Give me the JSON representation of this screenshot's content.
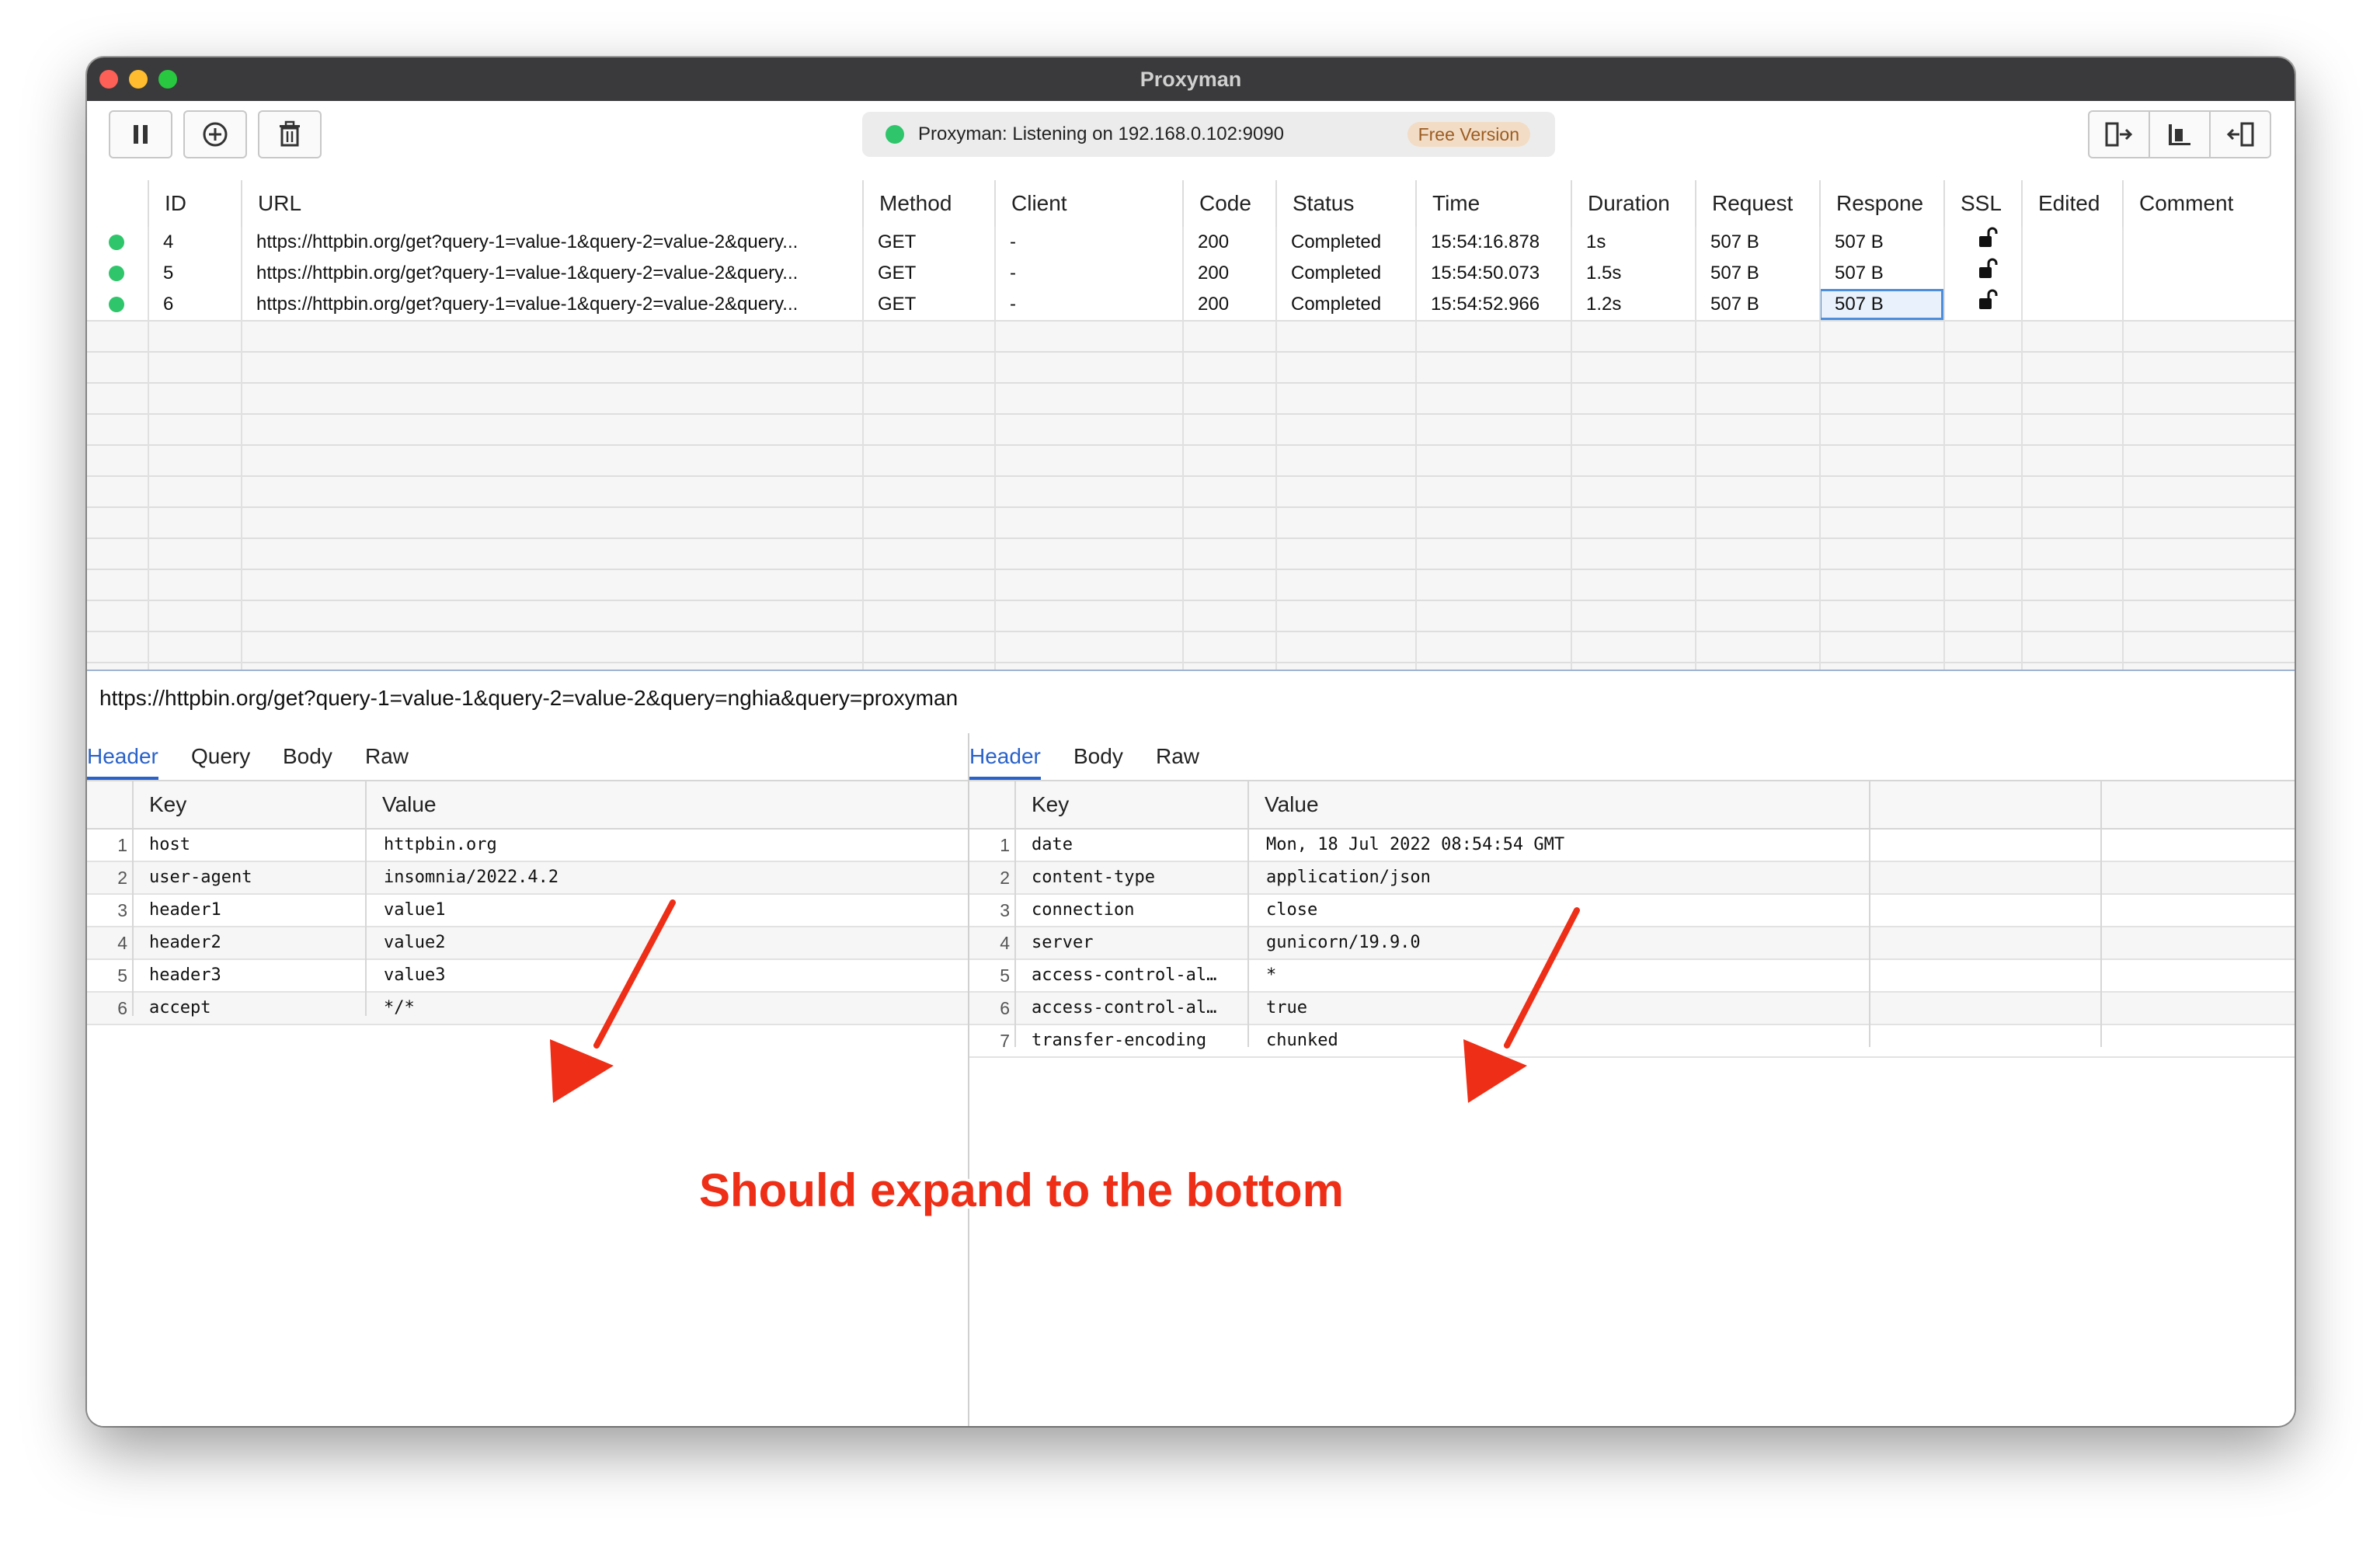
{
  "window": {
    "title": "Proxyman"
  },
  "toolbar": {
    "status_text": "Proxyman: Listening on 192.168.0.102:9090",
    "badge": "Free Version",
    "status_color": "#2fc56b"
  },
  "request_table": {
    "columns": [
      "ID",
      "URL",
      "Method",
      "Client",
      "Code",
      "Status",
      "Time",
      "Duration",
      "Request",
      "Respone",
      "SSL",
      "Edited",
      "Comment"
    ],
    "rows": [
      {
        "id": "4",
        "url": "https://httpbin.org/get?query-1=value-1&query-2=value-2&query...",
        "method": "GET",
        "client": "-",
        "code": "200",
        "status": "Completed",
        "time": "15:54:16.878",
        "duration": "1s",
        "request": "507 B",
        "response": "507 B"
      },
      {
        "id": "5",
        "url": "https://httpbin.org/get?query-1=value-1&query-2=value-2&query...",
        "method": "GET",
        "client": "-",
        "code": "200",
        "status": "Completed",
        "time": "15:54:50.073",
        "duration": "1.5s",
        "request": "507 B",
        "response": "507 B"
      },
      {
        "id": "6",
        "url": "https://httpbin.org/get?query-1=value-1&query-2=value-2&query...",
        "method": "GET",
        "client": "-",
        "code": "200",
        "status": "Completed",
        "time": "15:54:52.966",
        "duration": "1.2s",
        "request": "507 B",
        "response": "507 B"
      }
    ]
  },
  "detail": {
    "url": "https://httpbin.org/get?query-1=value-1&query-2=value-2&query=nghia&query=proxyman"
  },
  "request_pane": {
    "tabs": [
      "Header",
      "Query",
      "Body",
      "Raw"
    ],
    "columns": [
      "Key",
      "Value"
    ],
    "rows": [
      {
        "n": "1",
        "key": "host",
        "value": "httpbin.org"
      },
      {
        "n": "2",
        "key": "user-agent",
        "value": "insomnia/2022.4.2"
      },
      {
        "n": "3",
        "key": "header1",
        "value": "value1"
      },
      {
        "n": "4",
        "key": "header2",
        "value": "value2"
      },
      {
        "n": "5",
        "key": "header3",
        "value": "value3"
      },
      {
        "n": "6",
        "key": "accept",
        "value": "*/*"
      }
    ]
  },
  "response_pane": {
    "tabs": [
      "Header",
      "Body",
      "Raw"
    ],
    "columns": [
      "Key",
      "Value"
    ],
    "rows": [
      {
        "n": "1",
        "key": "date",
        "value": "Mon, 18 Jul 2022 08:54:54 GMT"
      },
      {
        "n": "2",
        "key": "content-type",
        "value": "application/json"
      },
      {
        "n": "3",
        "key": "connection",
        "value": "close"
      },
      {
        "n": "4",
        "key": "server",
        "value": "gunicorn/19.9.0"
      },
      {
        "n": "5",
        "key": "access-control-al…",
        "value": "*"
      },
      {
        "n": "6",
        "key": "access-control-al…",
        "value": "true"
      },
      {
        "n": "7",
        "key": "transfer-encoding",
        "value": "chunked"
      }
    ]
  },
  "annotation": {
    "text": "Should expand to the bottom",
    "color": "#ee2e16"
  }
}
